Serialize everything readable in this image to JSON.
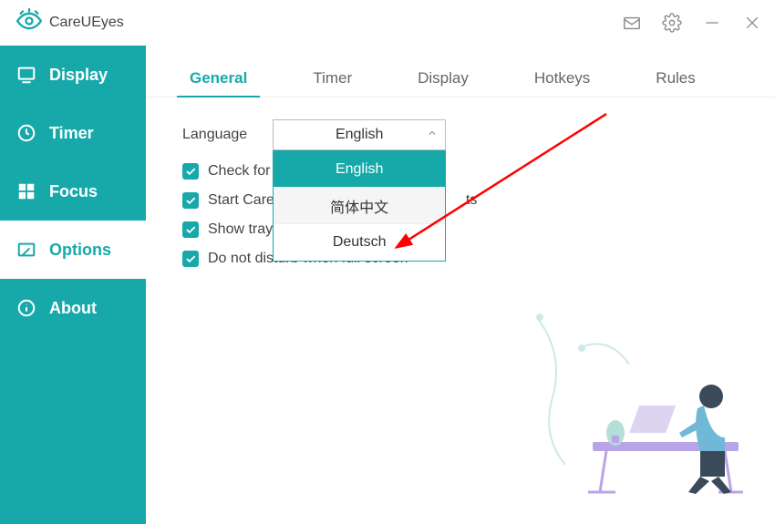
{
  "app": {
    "title": "CareUEyes"
  },
  "sidebar": {
    "items": [
      {
        "label": "Display"
      },
      {
        "label": "Timer"
      },
      {
        "label": "Focus"
      },
      {
        "label": "Options"
      },
      {
        "label": "About"
      }
    ]
  },
  "tabs": [
    {
      "label": "General"
    },
    {
      "label": "Timer"
    },
    {
      "label": "Display"
    },
    {
      "label": "Hotkeys"
    },
    {
      "label": "Rules"
    }
  ],
  "panel": {
    "language_label": "Language",
    "language_value": "English",
    "options": [
      {
        "label": "English"
      },
      {
        "label": "简体中文"
      },
      {
        "label": "Deutsch"
      }
    ],
    "checkbox1_prefix": "Check for ",
    "checkbox2_prefix": "Start Care",
    "checkbox2_suffix": "ts",
    "checkbox3": "Show tray",
    "checkbox4": "Do not disturb when full screen"
  }
}
